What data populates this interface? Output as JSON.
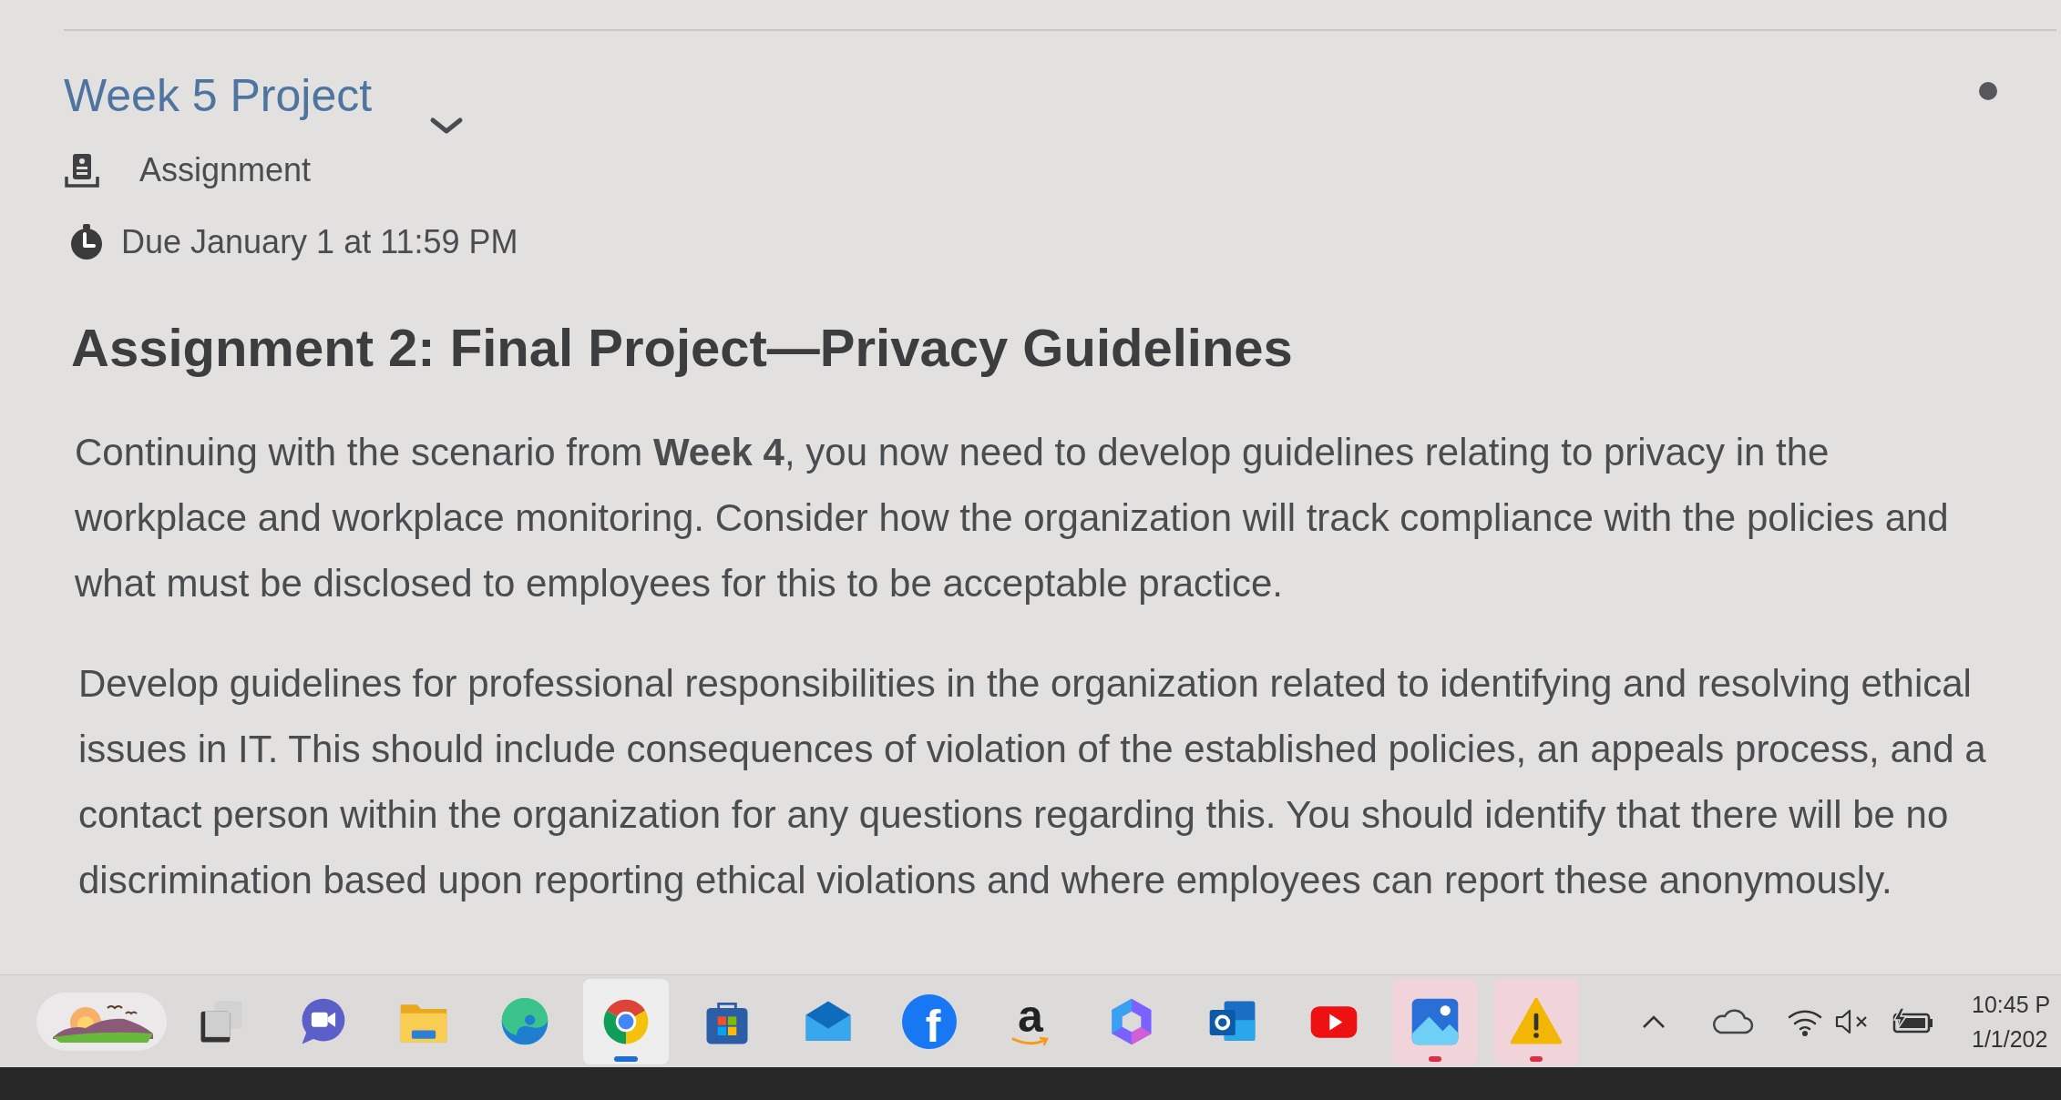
{
  "page": {
    "item": {
      "title": "Week 5 Project",
      "type_label": "Assignment",
      "due": "Due January 1 at 11:59 PM"
    },
    "heading": "Assignment 2: Final Project—Privacy Guidelines",
    "paragraphs": [
      "Continuing with the scenario from **Week 4**, you now need to develop guidelines relating to privacy in the workplace and workplace monitoring. Consider how the organization will track compliance with the policies and what must be disclosed to employees for this to be acceptable practice.",
      "Develop guidelines for professional responsibilities in the organization related to identifying and resolving ethical issues in IT. This should include consequences of violation of the established policies, an appeals process, and a contact person within the organization for any questions regarding this. You should identify that there will be no discrimination based upon reporting ethical violations and where employees can report these anonymously."
    ]
  },
  "taskbar": {
    "apps": [
      {
        "selected": false,
        "attention": false
      },
      {
        "selected": false,
        "attention": false
      },
      {
        "selected": false,
        "attention": false
      },
      {
        "selected": false,
        "attention": false
      },
      {
        "selected": true,
        "attention": false
      },
      {
        "selected": false,
        "attention": false
      },
      {
        "selected": false,
        "attention": false
      },
      {
        "selected": false,
        "attention": false,
        "glyph": "f"
      },
      {
        "selected": false,
        "attention": false,
        "glyph": "a"
      },
      {
        "selected": false,
        "attention": false
      },
      {
        "selected": false,
        "attention": false
      },
      {
        "selected": false,
        "attention": false
      },
      {
        "selected": false,
        "attention": true
      },
      {
        "selected": false,
        "attention": true
      }
    ],
    "tray": {
      "muted": true
    },
    "clock": {
      "time": "10:45 P",
      "date": "1/1/202"
    }
  }
}
